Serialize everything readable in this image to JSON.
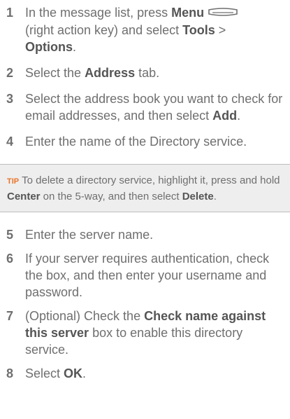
{
  "steps": [
    {
      "num": "1",
      "t1": "In the message list, press ",
      "b1": "Menu",
      "t2": "(right action key) and select ",
      "b2": "Tools",
      "t3": " > ",
      "b3": "Options",
      "t4": "."
    },
    {
      "num": "2",
      "t1": "Select the ",
      "b1": "Address",
      "t2": " tab."
    },
    {
      "num": "3",
      "t1": "Select the address book you want to check for email addresses, and then select ",
      "b1": "Add",
      "t2": "."
    },
    {
      "num": "4",
      "t1": "Enter the name of the Directory service."
    },
    {
      "num": "5",
      "t1": "Enter the server name."
    },
    {
      "num": "6",
      "t1": "If your server requires authentication, check the box, and then enter your username and password."
    },
    {
      "num": "7",
      "t1": "(Optional)  Check the ",
      "b1": "Check name against this server",
      "t2": " box to enable this directory service."
    },
    {
      "num": "8",
      "t1": "Select ",
      "b1": "OK",
      "t2": "."
    }
  ],
  "tip": {
    "label": "TIP",
    "t1": "To delete a directory service, highlight it, press and hold ",
    "b1": "Center",
    "t2": " on the 5-way, and then select ",
    "b2": "Delete",
    "t3": "."
  },
  "icons": {
    "menu_key": "menu-key-icon"
  }
}
